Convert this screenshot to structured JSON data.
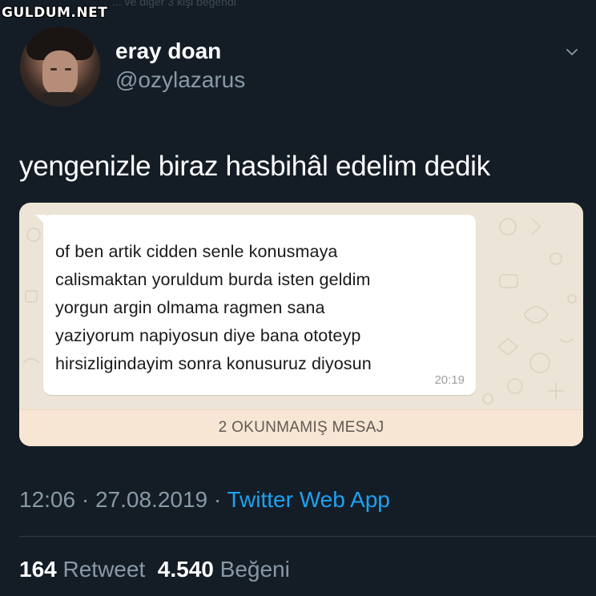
{
  "watermark": "GULDUM.NET",
  "top_fade_text": "... ve diğer 3 kişi beğendi",
  "user": {
    "display_name": "eray doan",
    "handle": "@ozylazarus"
  },
  "tweet": {
    "text": "yengenizle biraz hasbihâl edelim dedik",
    "timestamp_time": "12:06",
    "separator": " · ",
    "timestamp_date": "27.08.2019",
    "source": "Twitter Web App"
  },
  "chat_screenshot": {
    "message_lines": [
      "of ben artik cidden senle konusmaya",
      "calismaktan yoruldum burda isten geldim",
      "yorgun argin olmama ragmen sana",
      "yaziyorum napiyosun diye bana ototeyp",
      "hirsizligindayim sonra konusuruz diyosun"
    ],
    "message_time": "20:19",
    "unread_label": "2 OKUNMAMIŞ MESAJ"
  },
  "stats": {
    "retweets_count": "164",
    "retweets_label": "Retweet",
    "likes_count": "4.540",
    "likes_label": "Beğeni"
  },
  "colors": {
    "background": "#141d26",
    "secondary_text": "#8899a6",
    "link": "#1da1f2",
    "chat_wallpaper": "#ece4d6",
    "unread_bar": "#f7e6d3"
  },
  "icons": [
    "chevron-down-icon"
  ]
}
